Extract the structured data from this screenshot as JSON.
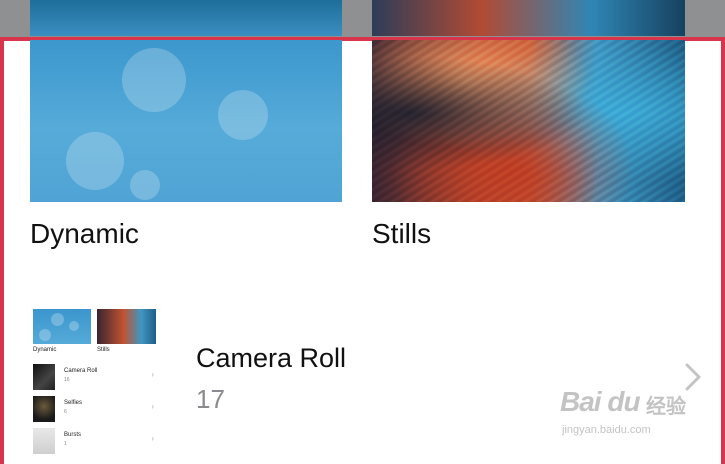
{
  "wallpapers": [
    {
      "id": "dynamic",
      "label": "Dynamic"
    },
    {
      "id": "stills",
      "label": "Stills"
    }
  ],
  "album": {
    "title": "Camera Roll",
    "count": "17",
    "chevron_icon": "chevron-right-icon"
  },
  "album_thumbnail": {
    "captions": [
      "Dynamic",
      "Stills"
    ],
    "rows": [
      {
        "name": "Camera Roll",
        "count": "16"
      },
      {
        "name": "Selfies",
        "count": "6"
      },
      {
        "name": "Bursts",
        "count": "1"
      }
    ]
  },
  "watermark": {
    "logo": "Bai du",
    "cn": "经验",
    "url": "jingyan.baidu.com"
  },
  "colors": {
    "highlight_border": "#d8344b",
    "dynamic_blue": "#4fa4d5",
    "count_gray": "#8a8a8f"
  }
}
